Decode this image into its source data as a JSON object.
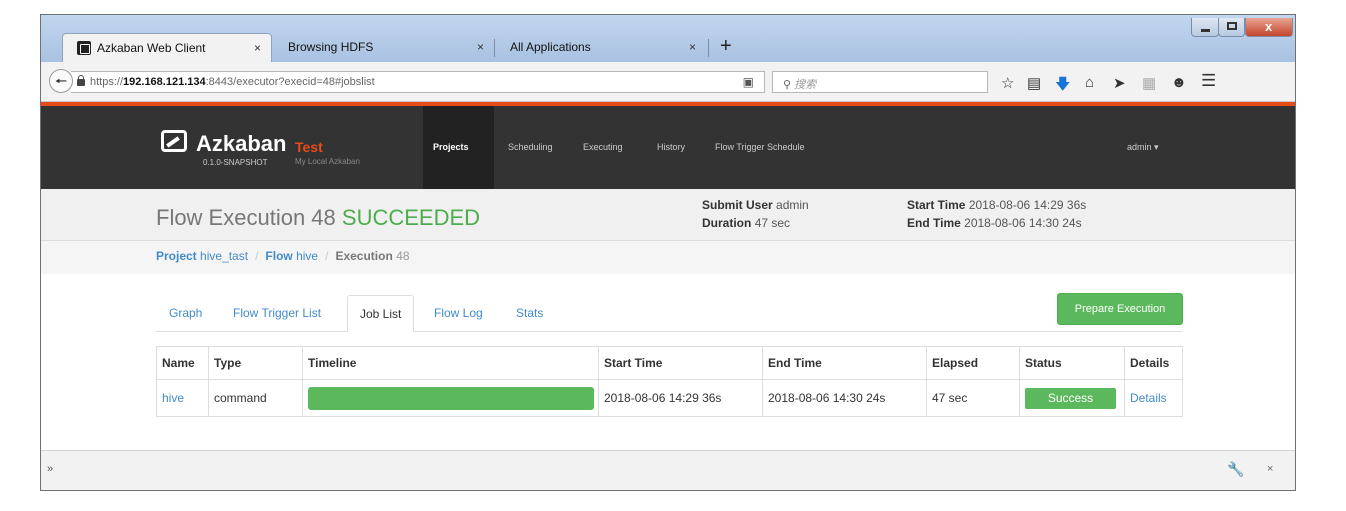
{
  "browser": {
    "tabs": [
      {
        "title": "Azkaban Web Client",
        "close": "×"
      },
      {
        "title": "Browsing HDFS",
        "close": "×"
      },
      {
        "title": "All Applications",
        "close": "×"
      }
    ],
    "new_tab": "+",
    "url_prefix": "https://",
    "url_host": "192.168.121.134",
    "url_rest": ":8443/executor?execid=48#jobslist",
    "search_placeholder": "搜索",
    "bottom_chevron": "»",
    "bottom_close": "×"
  },
  "navbar": {
    "brand": "Azkaban",
    "version": "0.1.0-SNAPSHOT",
    "env_name": "Test",
    "env_desc": "My Local Azkaban",
    "links": [
      "Projects",
      "Scheduling",
      "Executing",
      "History",
      "Flow Trigger Schedule"
    ],
    "user": "admin ▾"
  },
  "header": {
    "title_prefix": "Flow Execution 48",
    "title_status": "SUCCEEDED",
    "submit_user_label": "Submit User",
    "submit_user": "admin",
    "duration_label": "Duration",
    "duration": "47 sec",
    "start_time_label": "Start Time",
    "start_time": "2018-08-06 14:29 36s",
    "end_time_label": "End Time",
    "end_time": "2018-08-06 14:30 24s"
  },
  "breadcrumb": {
    "project_label": "Project",
    "project": "hive_tast",
    "flow_label": "Flow",
    "flow": "hive",
    "execution_label": "Execution",
    "execution": "48",
    "sep": "/"
  },
  "page_tabs": [
    "Graph",
    "Flow Trigger List",
    "Job List",
    "Flow Log",
    "Stats"
  ],
  "prepare_button": "Prepare Execution",
  "jobs_table": {
    "headers": [
      "Name",
      "Type",
      "Timeline",
      "Start Time",
      "End Time",
      "Elapsed",
      "Status",
      "Details"
    ],
    "rows": [
      {
        "name": "hive",
        "type": "command",
        "timeline_fraction": 1.0,
        "start_time": "2018-08-06 14:29 36s",
        "end_time": "2018-08-06 14:30 24s",
        "elapsed": "47 sec",
        "status": "Success",
        "details": "Details"
      }
    ]
  },
  "colors": {
    "success": "#5cb85c",
    "link": "#428bca",
    "accent": "#e74b1a",
    "navbar": "#333333"
  },
  "icons": [
    "back-icon",
    "lock-icon",
    "reader-icon",
    "search-icon",
    "star-icon",
    "library-icon",
    "download-icon",
    "home-icon",
    "send-icon",
    "screenshot-icon",
    "emoji-icon",
    "menu-icon",
    "wrench-icon"
  ]
}
